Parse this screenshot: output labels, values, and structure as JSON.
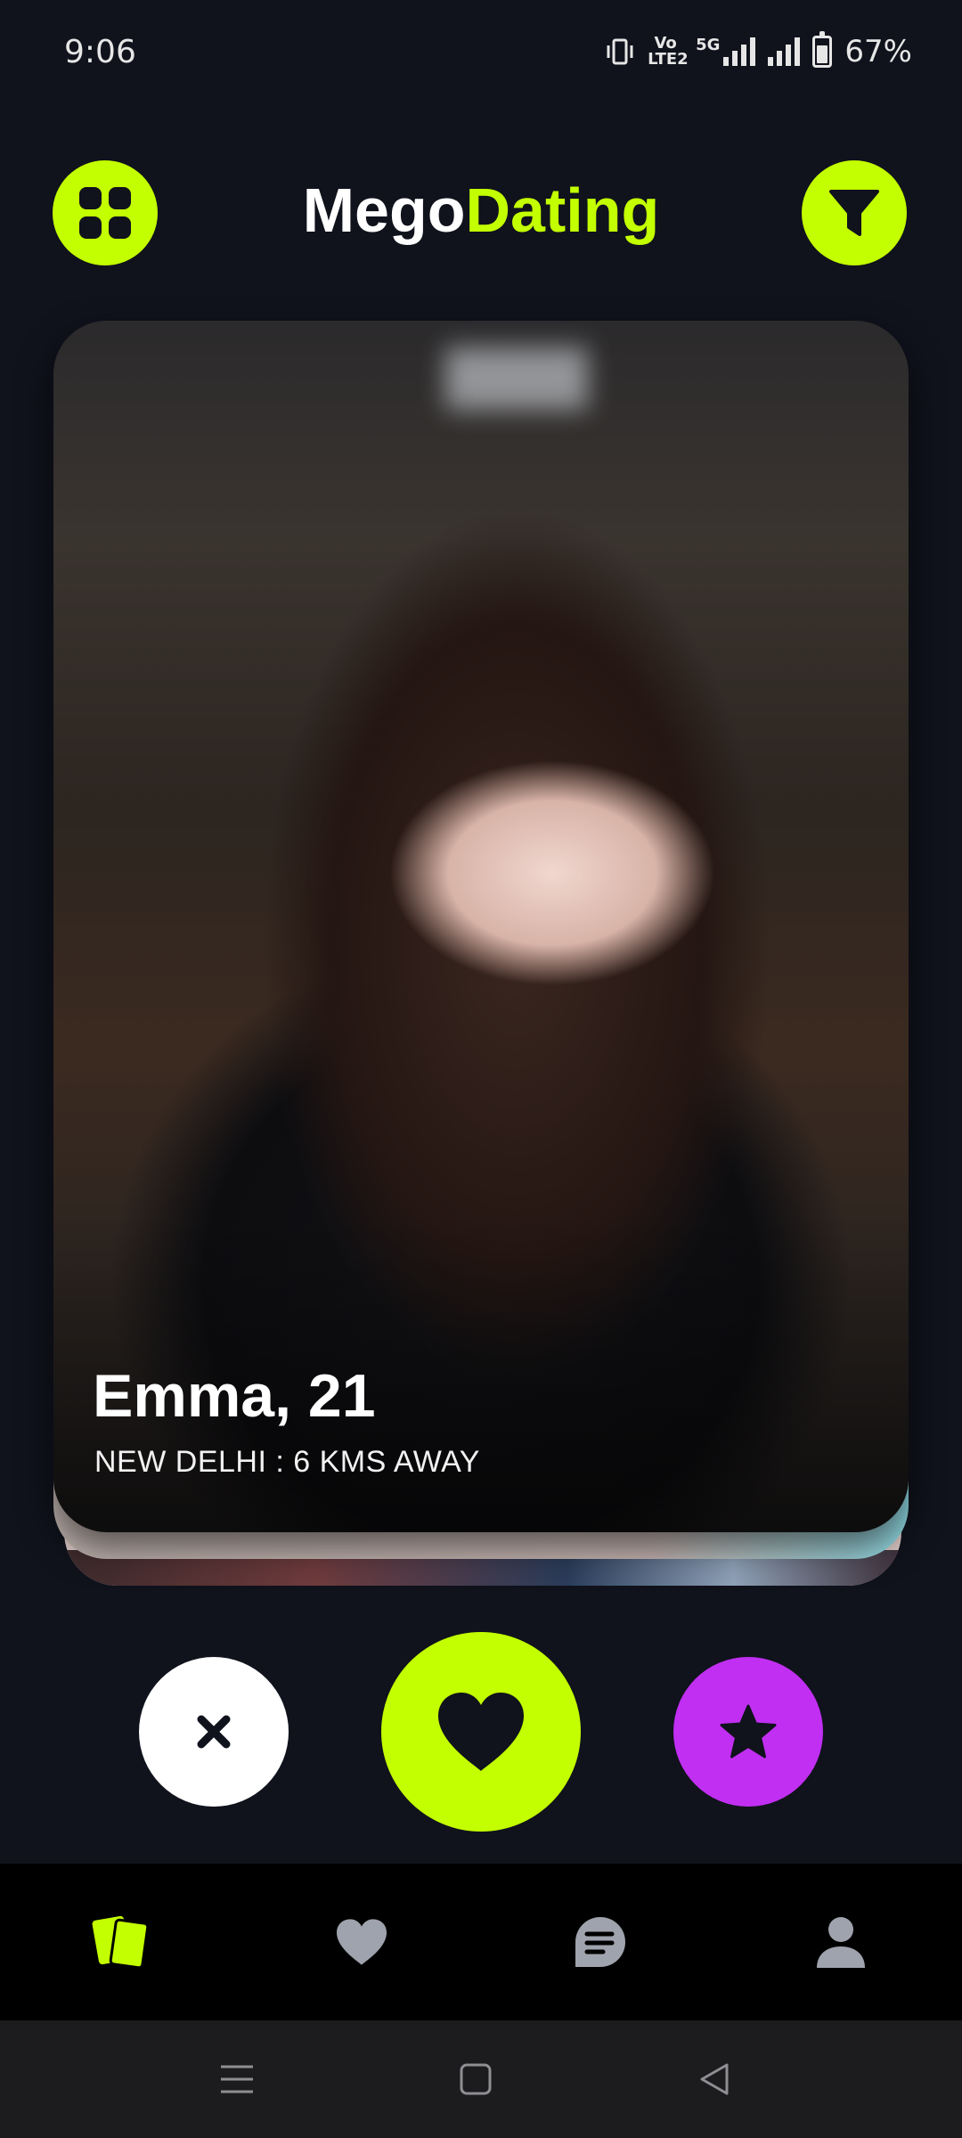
{
  "status_bar": {
    "time": "9:06",
    "volte_label": "Vo LTE2",
    "network_label": "5G",
    "battery_percent": "67%"
  },
  "header": {
    "title_part1": "Mego",
    "title_part2": "Dating",
    "menu_icon": "grid-icon",
    "filter_icon": "filter-icon"
  },
  "profile_card": {
    "name_age": "Emma, 21",
    "location": "NEW DELHI : 6 KMS AWAY"
  },
  "actions": {
    "dislike_icon": "close-icon",
    "like_icon": "heart-icon",
    "superlike_icon": "star-icon"
  },
  "bottom_nav": {
    "items": [
      {
        "icon": "cards-icon",
        "active": true
      },
      {
        "icon": "heart-icon",
        "active": false
      },
      {
        "icon": "chat-icon",
        "active": false
      },
      {
        "icon": "person-icon",
        "active": false
      }
    ]
  },
  "colors": {
    "accent": "#c3ff00",
    "superlike": "#c12ff2",
    "background": "#10121c",
    "nav_inactive": "#9fa3ad"
  }
}
